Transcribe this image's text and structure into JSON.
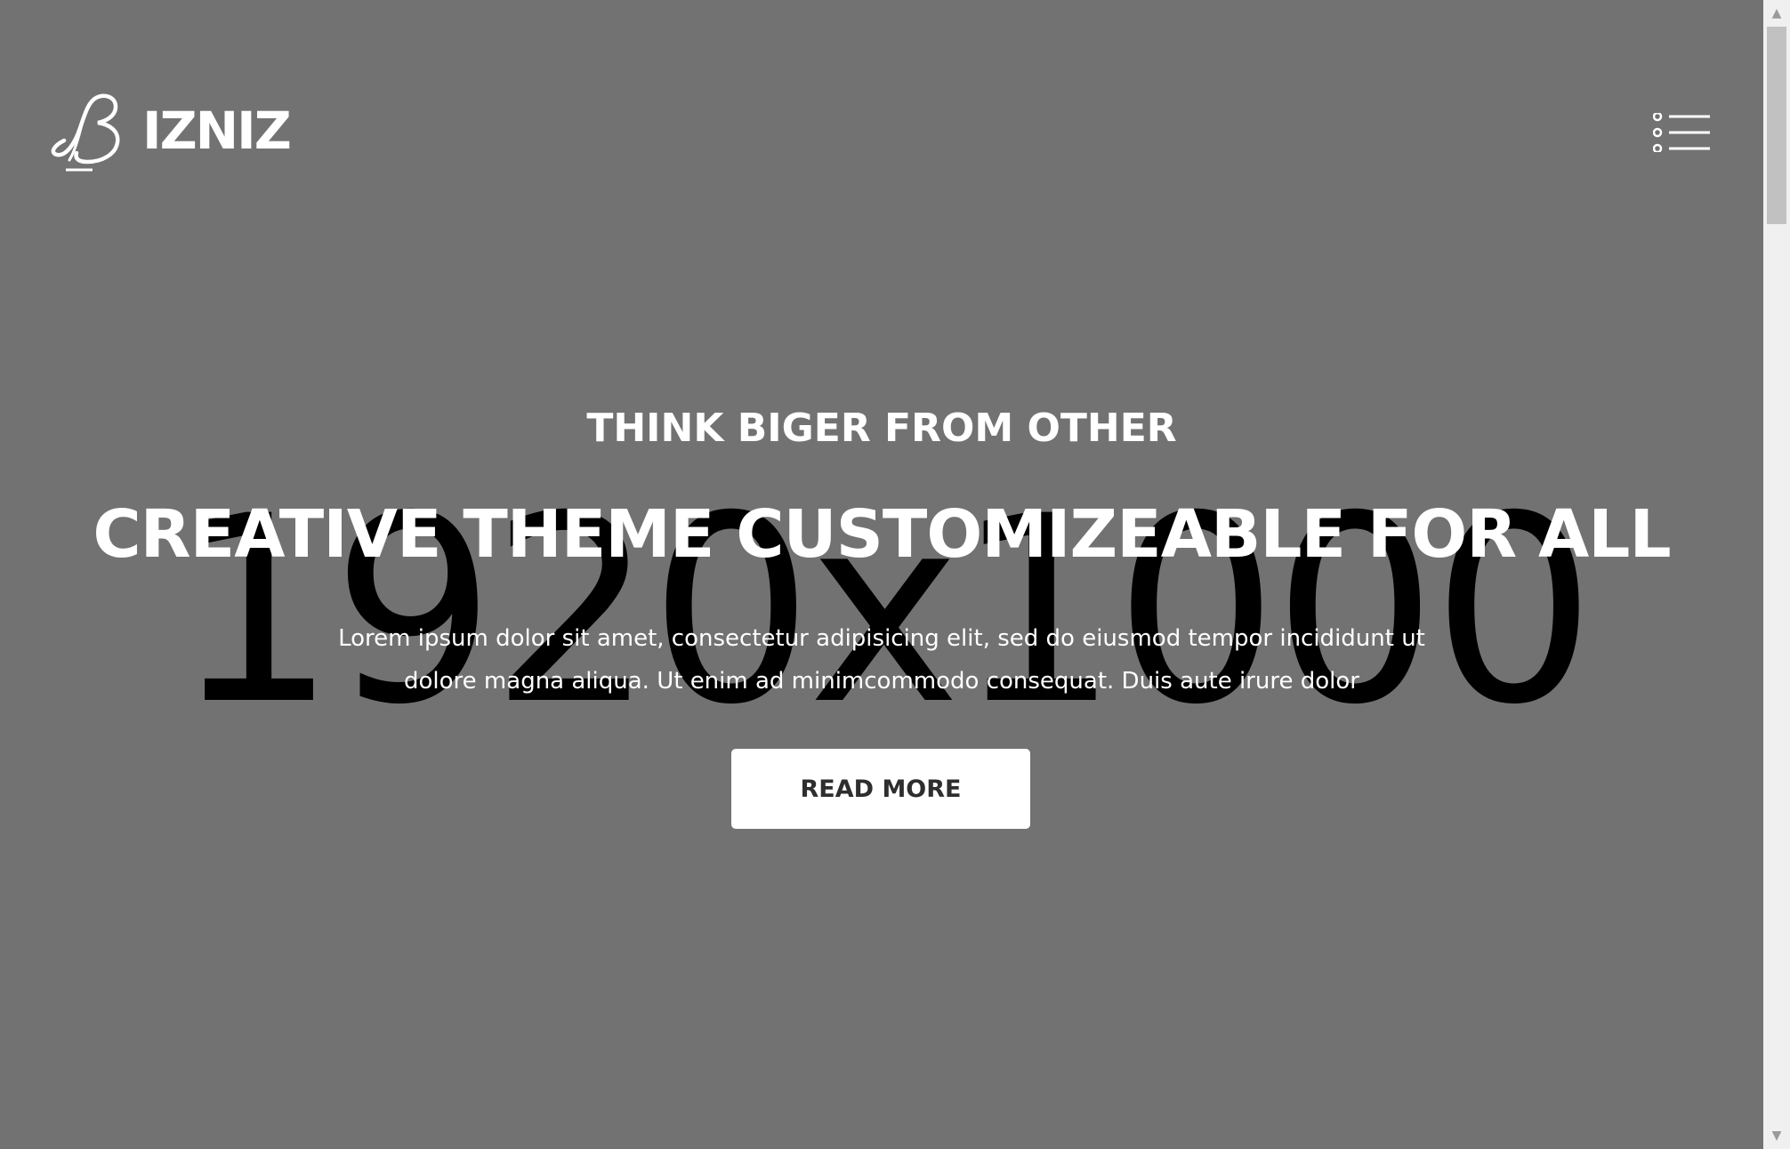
{
  "placeholder": {
    "dimensions_text": "1920x1000"
  },
  "brand": {
    "monogram": "B",
    "wordmark": "IZNIZ",
    "mark_icon": "script-b-icon"
  },
  "header": {
    "menu_icon": "hamburger-menu-icon"
  },
  "hero": {
    "kicker": "THINK BIGER FROM OTHER",
    "headline": "CREATIVE THEME CUSTOMIZEABLE FOR ALL",
    "description": "Lorem ipsum dolor sit amet, consectetur adipisicing elit, sed do eiusmod tempor incididunt ut dolore magna aliqua. Ut enim ad minimcommodo consequat. Duis aute irure dolor",
    "cta_label": "READ MORE"
  },
  "scrollbar": {
    "up_icon": "scroll-up-arrow-icon",
    "down_icon": "scroll-down-arrow-icon"
  },
  "colors": {
    "background": "#727272",
    "text": "#ffffff",
    "button_bg": "#ffffff",
    "button_text": "#2e2e2e"
  }
}
